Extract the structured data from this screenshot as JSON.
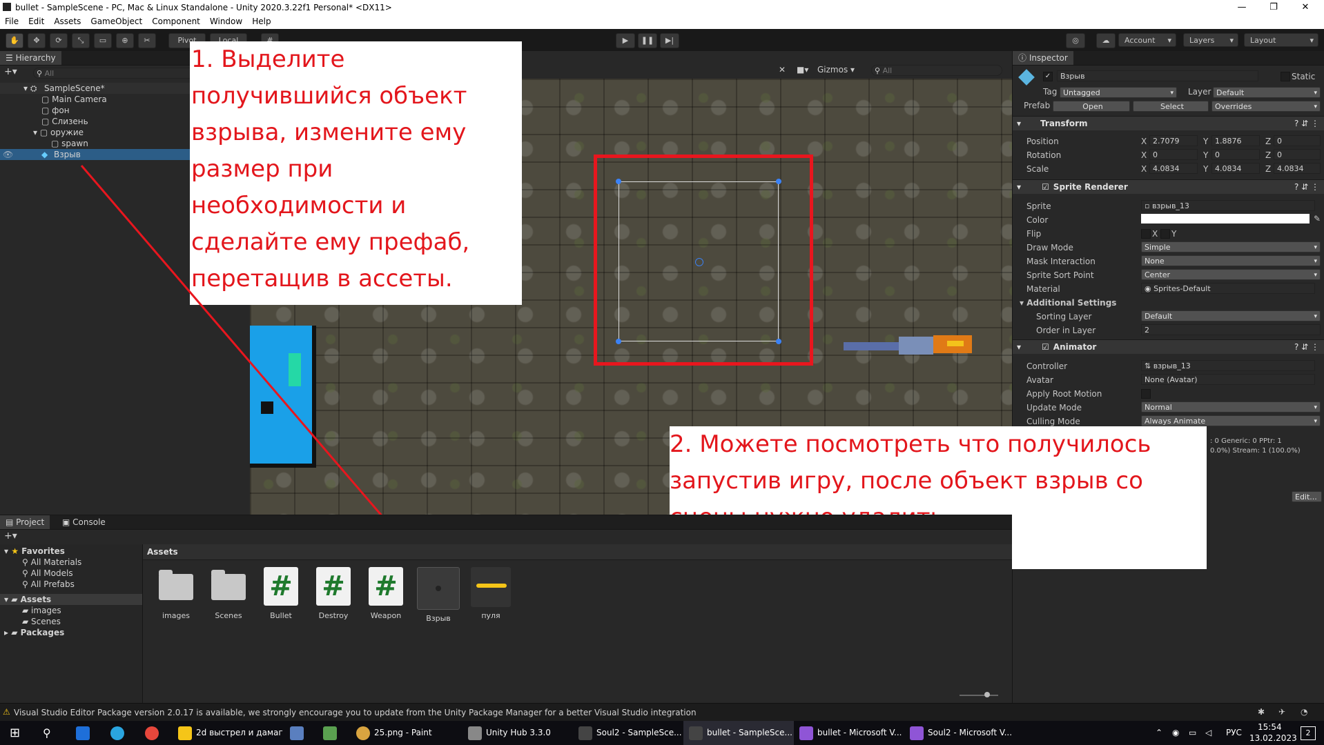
{
  "window": {
    "title": "bullet - SampleScene - PC, Mac & Linux Standalone - Unity 2020.3.22f1 Personal* <DX11>",
    "controls": [
      "—",
      "❐",
      "✕"
    ]
  },
  "menu": [
    "File",
    "Edit",
    "Assets",
    "GameObject",
    "Component",
    "Window",
    "Help"
  ],
  "toolbar": {
    "pivot_label": "Pivot",
    "local_label": "Local",
    "account_label": "Account",
    "layers_label": "Layers",
    "layout_label": "Layout"
  },
  "hierarchy": {
    "tab_label": "Hierarchy",
    "search_placeholder": "All",
    "items": [
      {
        "label": "SampleScene*",
        "indent": 0
      },
      {
        "label": "Main Camera",
        "indent": 1
      },
      {
        "label": "фон",
        "indent": 1
      },
      {
        "label": "Слизень",
        "indent": 1
      },
      {
        "label": "оружие",
        "indent": 1
      },
      {
        "label": "spawn",
        "indent": 2
      },
      {
        "label": "Взрыв",
        "indent": 1,
        "selected": true
      }
    ]
  },
  "scene": {
    "gizmos_label": "Gizmos",
    "search_placeholder": "All"
  },
  "inspector": {
    "tab_label": "Inspector",
    "object_name": "Взрыв",
    "static_label": "Static",
    "tag_label": "Tag",
    "tag_value": "Untagged",
    "layer_label": "Layer",
    "layer_value": "Default",
    "prefab_label": "Prefab",
    "prefab_open": "Open",
    "prefab_select": "Select",
    "prefab_overrides": "Overrides",
    "transform": {
      "title": "Transform",
      "position_label": "Position",
      "rotation_label": "Rotation",
      "scale_label": "Scale",
      "position": {
        "x": "2.7079",
        "y": "1.8876",
        "z": "0"
      },
      "rotation": {
        "x": "0",
        "y": "0",
        "z": "0"
      },
      "scale": {
        "x": "4.0834",
        "y": "4.0834",
        "z": "4.0834"
      }
    },
    "sprite_renderer": {
      "title": "Sprite Renderer",
      "sprite_label": "Sprite",
      "sprite_value": "взрыв_13",
      "color_label": "Color",
      "flip_label": "Flip",
      "flip_x": "X",
      "flip_y": "Y",
      "draw_mode_label": "Draw Mode",
      "draw_mode_value": "Simple",
      "mask_label": "Mask Interaction",
      "mask_value": "None",
      "sort_point_label": "Sprite Sort Point",
      "sort_point_value": "Center",
      "material_label": "Material",
      "material_value": "Sprites-Default",
      "additional_label": "Additional Settings",
      "sorting_layer_label": "Sorting Layer",
      "sorting_layer_value": "Default",
      "order_label": "Order in Layer",
      "order_value": "2"
    },
    "animator": {
      "title": "Animator",
      "controller_label": "Controller",
      "controller_value": "взрыв_13",
      "avatar_label": "Avatar",
      "avatar_value": "None (Avatar)",
      "root_motion_label": "Apply Root Motion",
      "update_label": "Update Mode",
      "update_value": "Normal",
      "culling_label": "Culling Mode",
      "culling_value": "Always Animate",
      "info_line1": ": 0 Generic: 0 PPtr: 1",
      "info_line2": "0.0%) Stream: 1 (100.0%)"
    },
    "edit_label": "Edit..."
  },
  "project": {
    "tab_project": "Project",
    "tab_console": "Console",
    "favorites_label": "Favorites",
    "favorites": [
      "All Materials",
      "All Models",
      "All Prefabs"
    ],
    "assets_label": "Assets",
    "asset_folders": [
      "images",
      "Scenes"
    ],
    "packages_label": "Packages",
    "breadcrumb": "Assets",
    "items": [
      {
        "label": "images",
        "kind": "folder"
      },
      {
        "label": "Scenes",
        "kind": "folder"
      },
      {
        "label": "Bullet",
        "kind": "script"
      },
      {
        "label": "Destroy",
        "kind": "script"
      },
      {
        "label": "Weapon",
        "kind": "script"
      },
      {
        "label": "Взрыв",
        "kind": "prefab"
      },
      {
        "label": "пуля",
        "kind": "sprite"
      }
    ]
  },
  "status_bar": {
    "message": "Visual Studio Editor Package version 2.0.17 is available, we strongly encourage you to update from the Unity Package Manager for a better Visual Studio integration"
  },
  "annotations": {
    "note1": "1. Выделите\nполучившийся объект\nвзрыва, измените ему\nразмер при\nнеобходимости и\nсделайте ему префаб,\nперетащив в ассеты.",
    "note2": "2. Можете посмотреть что получилось\nзапустив игру, после объект взрыв со\nсцены нужно удалить."
  },
  "taskbar": {
    "items": [
      "2d выстрел и дамаг",
      "25.png - Paint",
      "Unity Hub 3.3.0",
      "Soul2 - SampleSce...",
      "bullet - SampleSce...",
      "bullet - Microsoft V...",
      "Soul2 - Microsoft V..."
    ],
    "lang": "РУС",
    "time": "15:54",
    "date": "13.02.2023",
    "notif_count": "2"
  }
}
